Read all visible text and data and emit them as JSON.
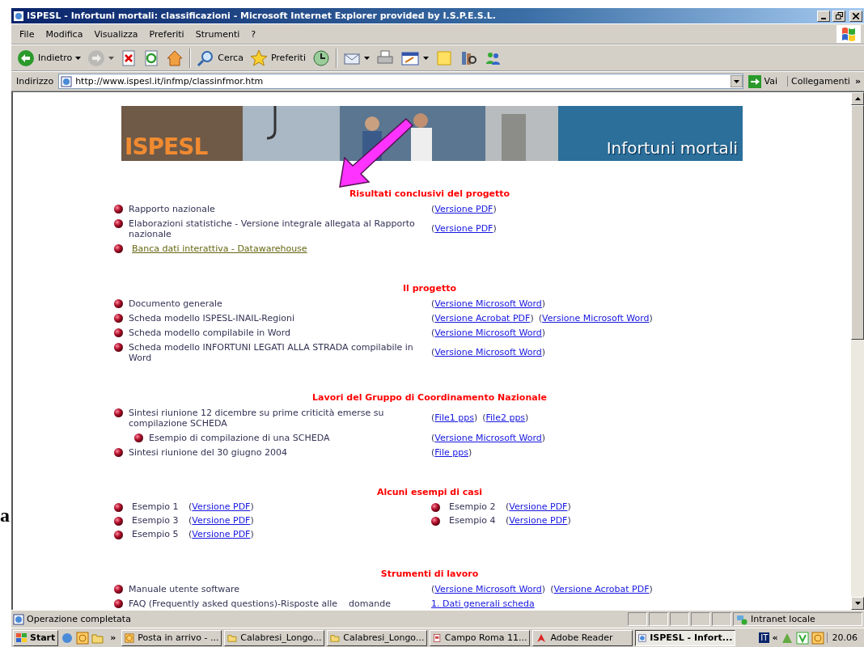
{
  "slide_text": "a",
  "window": {
    "title": "ISPESL - Infortuni mortali: classificazioni - Microsoft Internet Explorer provided by I.S.P.E.S.L."
  },
  "menu": [
    "File",
    "Modifica",
    "Visualizza",
    "Preferiti",
    "Strumenti",
    "?"
  ],
  "toolbar": [
    {
      "kind": "back",
      "label": "Indietro",
      "dropdown": true,
      "disabled": false
    },
    {
      "kind": "forward",
      "dropdown": true,
      "disabled": true
    },
    {
      "kind": "stop",
      "dropdown": false,
      "disabled": false
    },
    {
      "kind": "refresh",
      "dropdown": false,
      "disabled": false
    },
    {
      "kind": "home",
      "dropdown": false,
      "disabled": false
    },
    {
      "kind": "search",
      "label": "Cerca",
      "dropdown": false,
      "disabled": false
    },
    {
      "kind": "favorites",
      "label": "Preferiti",
      "dropdown": false,
      "disabled": false
    },
    {
      "kind": "history",
      "dropdown": false,
      "disabled": false
    },
    {
      "kind": "mail",
      "dropdown": true,
      "disabled": false
    },
    {
      "kind": "print",
      "dropdown": false,
      "disabled": false
    },
    {
      "kind": "edit",
      "dropdown": true,
      "disabled": false
    },
    {
      "kind": "notes",
      "dropdown": false,
      "disabled": false
    },
    {
      "kind": "research",
      "dropdown": false,
      "disabled": false
    },
    {
      "kind": "messenger",
      "dropdown": false,
      "disabled": false
    }
  ],
  "address": {
    "label": "Indirizzo",
    "value": "http://www.ispesl.it/infmp/classinfmor.htm",
    "go": "Vai",
    "links": "Collegamenti",
    "more": "»"
  },
  "banner": {
    "logo": "ISPESL",
    "title": "Infortuni mortali"
  },
  "sections": [
    {
      "title": "Risultati conclusivi del progetto",
      "kind": "list",
      "rows": [
        {
          "text": "Rapporto nazionale",
          "kind": "text",
          "links": [
            {
              "before": "(",
              "label": "Versione PDF",
              "after": ")"
            }
          ]
        },
        {
          "text": "Elaborazioni statistiche - Versione integrale allegata al Rapporto nazionale",
          "kind": "text",
          "links": [
            {
              "before": "(",
              "label": "Versione PDF",
              "after": ")"
            }
          ]
        },
        {
          "text": "Banca dati interattiva - Datawarehouse",
          "kind": "link",
          "links": []
        }
      ]
    },
    {
      "title": "Il progetto",
      "kind": "list",
      "rows": [
        {
          "text": "Documento generale",
          "kind": "text",
          "links": [
            {
              "before": "(",
              "label": "Versione Microsoft Word",
              "after": ")"
            }
          ]
        },
        {
          "text": "Scheda modello ISPESL-INAIL-Regioni",
          "kind": "text",
          "links": [
            {
              "before": "(",
              "label": "Versione Acrobat PDF",
              "after": ")"
            },
            {
              "before": "(",
              "label": "Versione Microsoft Word",
              "after": ")"
            }
          ]
        },
        {
          "text": "Scheda modello compilabile in Word",
          "kind": "text",
          "links": [
            {
              "before": "(",
              "label": "Versione Microsoft Word",
              "after": ")"
            }
          ]
        },
        {
          "text": "Scheda modello INFORTUNI LEGATI ALLA STRADA compilabile in Word",
          "kind": "text",
          "links": [
            {
              "before": "(",
              "label": "Versione Microsoft Word",
              "after": ")"
            }
          ]
        }
      ]
    },
    {
      "title": "Lavori del Gruppo di Coordinamento Nazionale",
      "kind": "list",
      "rows": [
        {
          "text": "Sintesi riunione 12 dicembre su prime criticità emerse su compilazione SCHEDA",
          "kind": "text",
          "links": [
            {
              "before": "(",
              "label": "File1 pps",
              "after": ")"
            },
            {
              "before": "(",
              "label": "File2 pps",
              "after": ")"
            }
          ],
          "children": [
            {
              "text": "Esempio di compilazione di una SCHEDA",
              "kind": "text",
              "links": [
                {
                  "before": "(",
                  "label": "Versione Microsoft Word",
                  "after": ")"
                }
              ]
            }
          ]
        },
        {
          "text": "Sintesi riunione del 30 giugno 2004",
          "kind": "text",
          "links": [
            {
              "before": "(",
              "label": "File pps",
              "after": ")"
            }
          ]
        }
      ]
    },
    {
      "title": "Alcuni esempi di casi",
      "kind": "grid",
      "rows": [
        {
          "text": "Esempio 1",
          "kind": "text",
          "links": [
            {
              "before": "(",
              "label": "Versione PDF",
              "after": ")"
            }
          ]
        },
        {
          "text": "Esempio 2",
          "kind": "text",
          "links": [
            {
              "before": "(",
              "label": "Versione PDF",
              "after": ")"
            }
          ]
        },
        {
          "text": "Esempio 3",
          "kind": "text",
          "links": [
            {
              "before": "(",
              "label": "Versione PDF",
              "after": ")"
            }
          ]
        },
        {
          "text": "Esempio 4",
          "kind": "text",
          "links": [
            {
              "before": "(",
              "label": "Versione PDF",
              "after": ")"
            }
          ]
        },
        {
          "text": "Esempio 5",
          "kind": "text",
          "links": [
            {
              "before": "(",
              "label": "Versione PDF",
              "after": ")"
            }
          ]
        }
      ]
    },
    {
      "title": "Strumenti di lavoro",
      "kind": "list",
      "rows": [
        {
          "text": "Manuale utente software",
          "kind": "text",
          "links": [
            {
              "before": "(",
              "label": "Versione Microsoft Word",
              "after": ")"
            },
            {
              "before": "(",
              "label": "Versione Acrobat PDF",
              "after": ")"
            }
          ]
        },
        {
          "text": "FAQ (Frequently asked questions)-Risposte alle    domande",
          "kind": "text",
          "links": [
            {
              "label": "1. Dati generali scheda"
            }
          ]
        }
      ]
    }
  ],
  "status": {
    "text": "Operazione completata",
    "zone": "Intranet locale"
  },
  "taskbar": {
    "start": "Start",
    "more": "»",
    "tasks": [
      {
        "label": "Posta in arrivo - ...",
        "kind": "mail",
        "selected": false
      },
      {
        "label": "Calabresi_Longo...",
        "kind": "folder",
        "selected": false
      },
      {
        "label": "Calabresi_Longo...",
        "kind": "folder",
        "selected": false
      },
      {
        "label": "Campo Roma 11...",
        "kind": "document",
        "selected": false
      },
      {
        "label": "Adobe Reader",
        "kind": "reader",
        "selected": false
      },
      {
        "label": "ISPESL - Infort...",
        "kind": "browser",
        "selected": true
      }
    ],
    "language": "IT",
    "tray_more": "«",
    "clock": "20.06"
  }
}
